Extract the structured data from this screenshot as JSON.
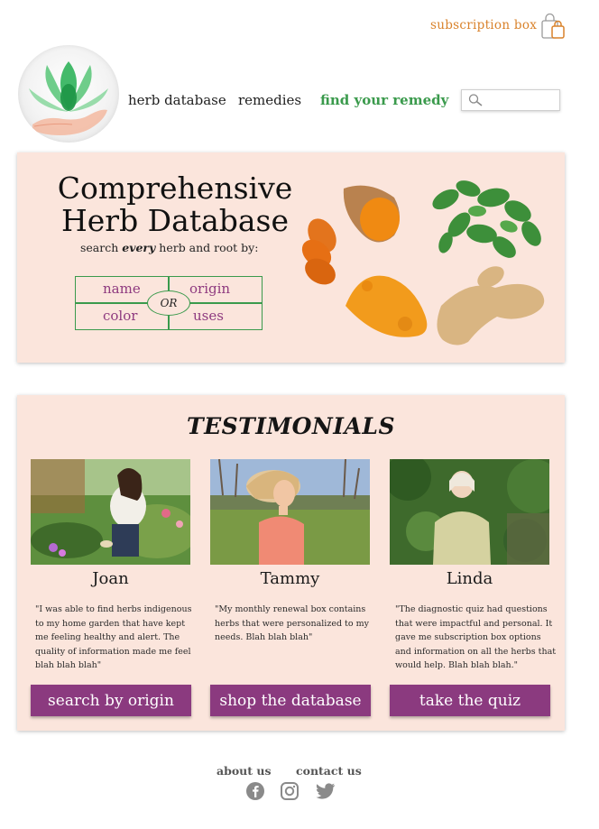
{
  "header": {
    "subscription_label": "subscription  box"
  },
  "nav": {
    "herb_database": "herb database",
    "remedies": "remedies",
    "find_remedy": "find your remedy",
    "search_placeholder": ""
  },
  "hero": {
    "title_line1": "Comprehensive",
    "title_line2": "Herb Database",
    "sub_pre": "search ",
    "sub_em": "every",
    "sub_post": " herb and root by:",
    "filters": {
      "name": "name",
      "origin": "origin",
      "color": "color",
      "uses": "uses",
      "or": "OR"
    }
  },
  "testimonials": {
    "title": "TESTIMONIALS",
    "people": [
      {
        "name": "Joan",
        "quote": "\"I was able to find herbs  indigenous to my home garden that have kept me feeling healthy and alert.  The quality of information made me feel blah blah blah\"",
        "button": "search by origin"
      },
      {
        "name": "Tammy",
        "quote": "\"My monthly renewal box  contains herbs that were personalized to my needs. Blah blah blah\"",
        "button": "shop the database"
      },
      {
        "name": "Linda",
        "quote": "\"The diagnostic quiz had questions that were impactful and personal.  It gave me subscription box options and information on all the herbs that would help. Blah blah blah.\"",
        "button": "take the quiz"
      }
    ]
  },
  "footer": {
    "about": "about us",
    "contact": "contact us",
    "social": [
      "facebook-icon",
      "instagram-icon",
      "twitter-icon"
    ]
  },
  "colors": {
    "accent_orange": "#d9822b",
    "accent_green": "#3a9a4c",
    "button_purple": "#8b3a7f",
    "panel_pink": "#fbe5dc"
  }
}
